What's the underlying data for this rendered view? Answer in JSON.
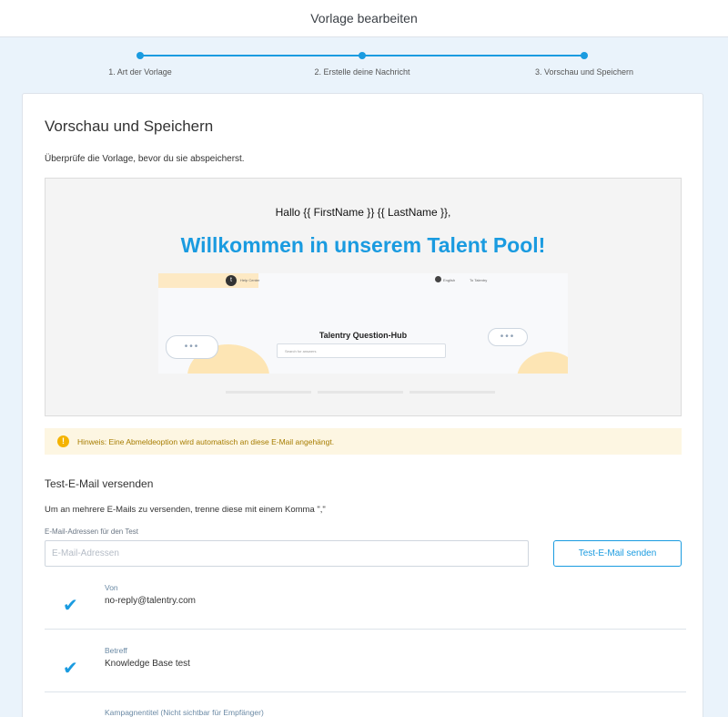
{
  "header": {
    "title": "Vorlage bearbeiten"
  },
  "stepper": {
    "steps": [
      {
        "label": "1. Art der Vorlage"
      },
      {
        "label": "2. Erstelle deine Nachricht"
      },
      {
        "label": "3. Vorschau und Speichern"
      }
    ],
    "accent": "#1a9be0"
  },
  "card": {
    "title": "Vorschau und Speichern",
    "subtitle": "Überprüfe die Vorlage, bevor du sie abspeicherst."
  },
  "preview": {
    "greeting": "Hallo {{ FirstName }} {{ LastName }},",
    "headline": "Willkommen in unserem Talent Pool!",
    "image": {
      "logo_letter": "t",
      "nav_left": "Help Center",
      "nav_lang": "English",
      "nav_right": "To Talentry",
      "hub_title": "Talentry Question-Hub",
      "search_placeholder": "Search for answers",
      "bubble_dots": "•••"
    }
  },
  "hint": {
    "icon": "!",
    "text": "Hinweis: Eine Abmeldeoption wird automatisch an diese E-Mail angehängt."
  },
  "test_email": {
    "title": "Test-E-Mail versenden",
    "description": "Um an mehrere E-Mails zu versenden, trenne diese mit einem Komma \",\"",
    "field_label": "E-Mail-Adressen für den Test",
    "placeholder": "E-Mail-Adressen",
    "button": "Test-E-Mail senden"
  },
  "details": [
    {
      "label": "Von",
      "value": "no-reply@talentry.com",
      "checked": true
    },
    {
      "label": "Betreff",
      "value": "Knowledge Base test",
      "checked": true
    },
    {
      "label": "Kampagnentitel (Nicht sichtbar für Empfänger)",
      "value": "",
      "checked": false
    }
  ]
}
